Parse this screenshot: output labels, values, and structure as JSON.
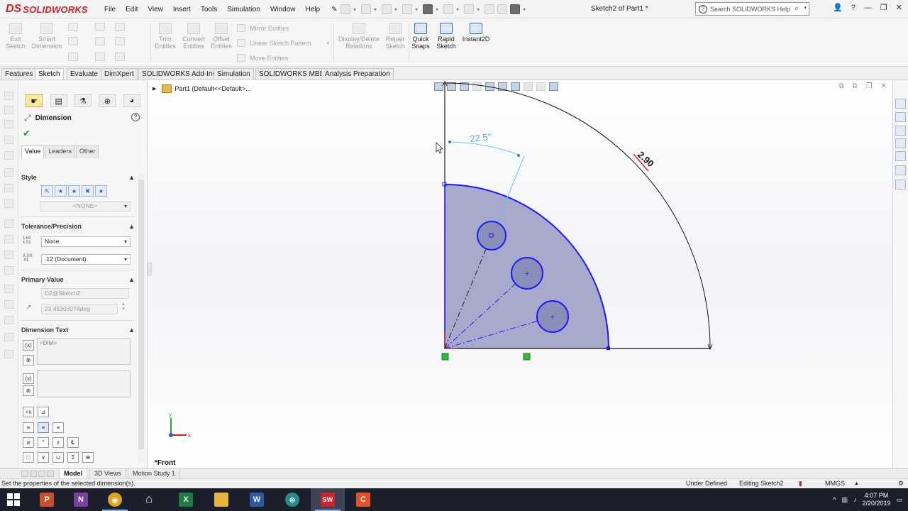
{
  "app": {
    "brand_ds": "DS",
    "brand": "SOLIDWORKS",
    "document_title": "Sketch2 of Part1 *",
    "search_placeholder": "Search SOLIDWORKS Help",
    "brand_color": "#d32027"
  },
  "menu": [
    "File",
    "Edit",
    "View",
    "Insert",
    "Tools",
    "Simulation",
    "Window",
    "Help"
  ],
  "commands": {
    "exit_sketch": "Exit Sketch",
    "smart_dimension": "Smart Dimension",
    "trim_entities": "Trim Entities",
    "convert_entities": "Convert Entities",
    "offset_entities": "Offset Entities",
    "mirror_entities": "Mirror Entities",
    "linear_sketch_pattern": "Linear Sketch Pattern",
    "move_entities": "Move Entities",
    "display_delete_relations": "Display/Delete Relations",
    "repair_sketch": "Repair Sketch",
    "quick_snaps": "Quick Snaps",
    "rapid_sketch": "Rapid Sketch",
    "instant2d": "Instant2D"
  },
  "tabs": [
    "Features",
    "Sketch",
    "Evaluate",
    "DimXpert",
    "SOLIDWORKS Add-Ins",
    "Simulation",
    "SOLIDWORKS MBD",
    "Analysis Preparation"
  ],
  "active_tab": "Sketch",
  "property_manager": {
    "title": "Dimension",
    "subtabs": [
      "Value",
      "Leaders",
      "Other"
    ],
    "style": {
      "header": "Style",
      "favorite": "<NONE>"
    },
    "tolerance": {
      "header": "Tolerance/Precision",
      "tol_icon": "1.50 ±.01",
      "prec_icon": "X.XX .01",
      "tolerance_type": "None",
      "precision": ".12 (Document)"
    },
    "primary_value": {
      "header": "Primary Value",
      "name": "D2@Sketch2",
      "value": "23.45303274deg"
    },
    "dimension_text": {
      "header": "Dimension Text",
      "text": "<DIM>"
    }
  },
  "feature_tree": {
    "root": "Part1  (Default<<Default>..."
  },
  "graphics": {
    "view_name": "*Front",
    "dim_angle": "22.5°",
    "dim_radius": "2.90",
    "axis_x": "x",
    "axis_y": "y",
    "sketch_blue": "#1a1aff",
    "fill_color": "#9fa3c4"
  },
  "model_tabs": [
    "Model",
    "3D Views",
    "Motion Study 1"
  ],
  "active_model_tab": "Model",
  "status": {
    "message": "Set the properties of the selected dimension(s).",
    "state": "Under Defined",
    "editing": "Editing Sketch2",
    "units": "MMGS"
  },
  "taskbar": {
    "time": "4:07 PM",
    "date": "2/20/2019"
  }
}
